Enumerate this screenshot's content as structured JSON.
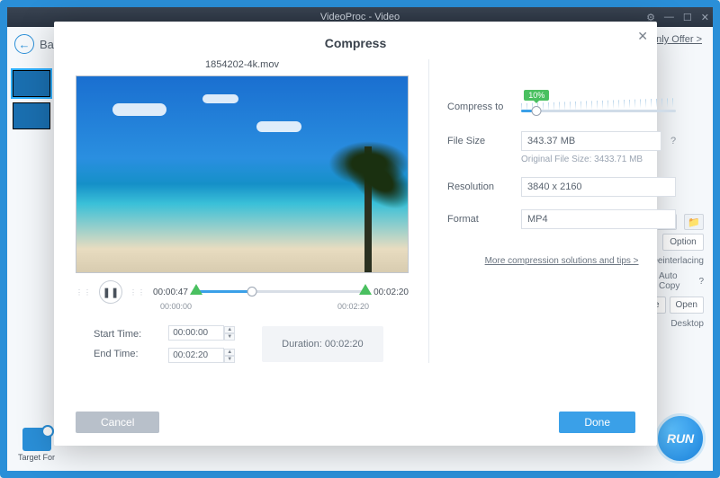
{
  "window": {
    "title": "VideoProc - Video",
    "back_label": "Ba",
    "offer_link": "only Offer >"
  },
  "right_stack": {
    "option": "Option",
    "deinterlacing": "Deinterlacing",
    "auto_copy": "Auto Copy",
    "qmark": "?",
    "browse": "se",
    "open": "Open",
    "desktop": "Desktop"
  },
  "run_label": "RUN",
  "target_format_label": "Target For",
  "modal": {
    "title": "Compress",
    "filename": "1854202-4k.mov",
    "play_current": "00:00:47",
    "play_total": "00:02:20",
    "seek_start": "00:00:00",
    "seek_end": "00:02:20",
    "start_time_label": "Start Time:",
    "end_time_label": "End Time:",
    "start_time_value": "00:00:00",
    "end_time_value": "00:02:20",
    "duration_label": "Duration:  00:02:20",
    "compress_to_label": "Compress to",
    "compress_badge": "10%",
    "filesize_label": "File Size",
    "filesize_value": "343.37 MB",
    "original_filesize": "Original File Size: 3433.71 MB",
    "resolution_label": "Resolution",
    "resolution_value": "3840 x 2160",
    "format_label": "Format",
    "format_value": "MP4",
    "tips_link": "More compression solutions and tips  >",
    "cancel": "Cancel",
    "done": "Done"
  }
}
